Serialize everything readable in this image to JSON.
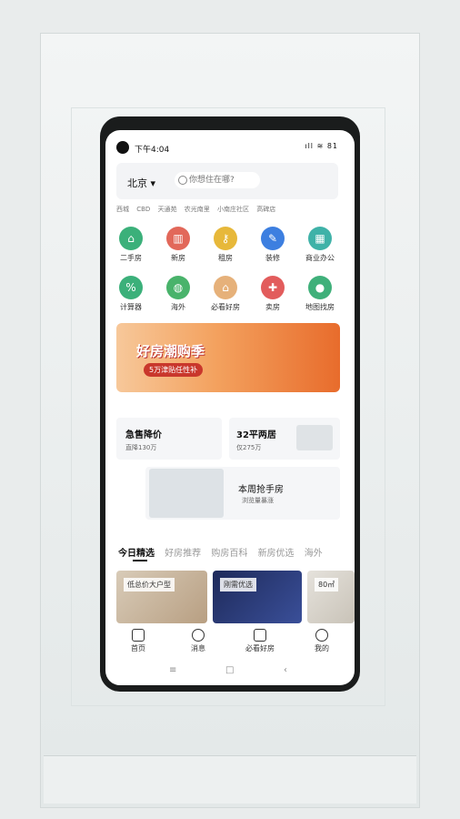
{
  "status_bar": {
    "time": "下午4:04",
    "icons": "ıll ≋ 81"
  },
  "search": {
    "city": "北京 ▾",
    "placeholder": "你想住在哪?"
  },
  "hot_tags": [
    "西城",
    "CBD",
    "天通苑",
    "农光南里",
    "小南庄社区",
    "高碑店"
  ],
  "grid_top": [
    {
      "label": "二手房",
      "color": "#3bb07a",
      "icon": "house-icon"
    },
    {
      "label": "新房",
      "color": "#e2685a",
      "icon": "building-icon"
    },
    {
      "label": "租房",
      "color": "#e7b83a",
      "icon": "key-icon"
    },
    {
      "label": "装修",
      "color": "#3d7fe0",
      "icon": "paint-icon"
    },
    {
      "label": "商业办公",
      "color": "#3fb2a8",
      "icon": "office-icon"
    }
  ],
  "grid_bottom": [
    {
      "label": "计算器",
      "color": "#3bb07a",
      "icon": "calculator-icon"
    },
    {
      "label": "海外",
      "color": "#49b36b",
      "icon": "globe-icon"
    },
    {
      "label": "必看好房",
      "color": "#e6b17a",
      "icon": "home-star-icon"
    },
    {
      "label": "卖房",
      "color": "#e25c5c",
      "icon": "tag-icon"
    },
    {
      "label": "地图找房",
      "color": "#3fb07a",
      "icon": "map-pin-icon"
    }
  ],
  "banner": {
    "title": "好房潮购季",
    "subtitle": "5万津贴任性补"
  },
  "deals": {
    "card1": {
      "title": "急售降价",
      "sub": "直降130万"
    },
    "card2": {
      "title": "32平两居",
      "sub": "仅275万"
    },
    "card3": {
      "title": "本周抢手房",
      "sub": "浏览量暴涨"
    }
  },
  "tabs": [
    "今日精选",
    "好房推荐",
    "购房百科",
    "新房优选",
    "海外"
  ],
  "photos": [
    {
      "label": "低总价大户型"
    },
    {
      "label": "刚需优选"
    },
    {
      "label": "80㎡"
    }
  ],
  "bottom_nav": [
    "首页",
    "消息",
    "必看好房",
    "我的"
  ],
  "system_nav": [
    "≡",
    "□",
    "‹"
  ]
}
